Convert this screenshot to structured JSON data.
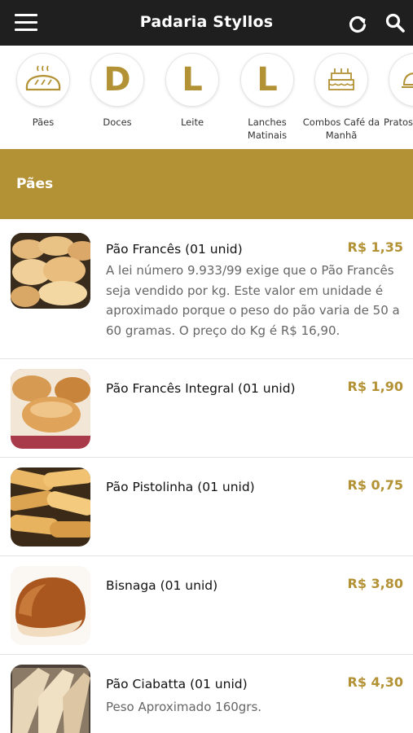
{
  "header": {
    "title": "Padaria Styllos",
    "icons": [
      "menu-icon",
      "refresh-icon",
      "search-icon"
    ]
  },
  "categories": [
    {
      "label": "Pães",
      "icon": "bread-icon"
    },
    {
      "label": "Doces",
      "letter": "D"
    },
    {
      "label": "Leite",
      "letter": "L"
    },
    {
      "label": "Lanches Matinais",
      "letter": "L"
    },
    {
      "label": "Combos Café da Manhã",
      "icon": "cake-icon"
    },
    {
      "label": "Pratos",
      "icon": "cloche-icon"
    }
  ],
  "section": {
    "title": "Pães"
  },
  "items": [
    {
      "name": "Pão Francês (01 unid)",
      "price": "R$ 1,35",
      "description": "A lei número 9.933/99 exige que o Pão Francês seja vendido por kg. Este valor em unidade é aproximado porque o peso do pão varia de 50 a 60 gramas. O preço do Kg é R$ 16,90."
    },
    {
      "name": "Pão Francês Integral (01 unid)",
      "price": "R$ 1,90",
      "description": ""
    },
    {
      "name": "Pão Pistolinha (01 unid)",
      "price": "R$ 0,75",
      "description": ""
    },
    {
      "name": "Bisnaga (01 unid)",
      "price": "R$ 3,80",
      "description": ""
    },
    {
      "name": "Pão Ciabatta (01 unid)",
      "price": "R$ 4,30",
      "description": "Peso Aproximado 160grs."
    }
  ],
  "colors": {
    "accent": "#b39236",
    "header_bg": "#1f1f1f"
  }
}
